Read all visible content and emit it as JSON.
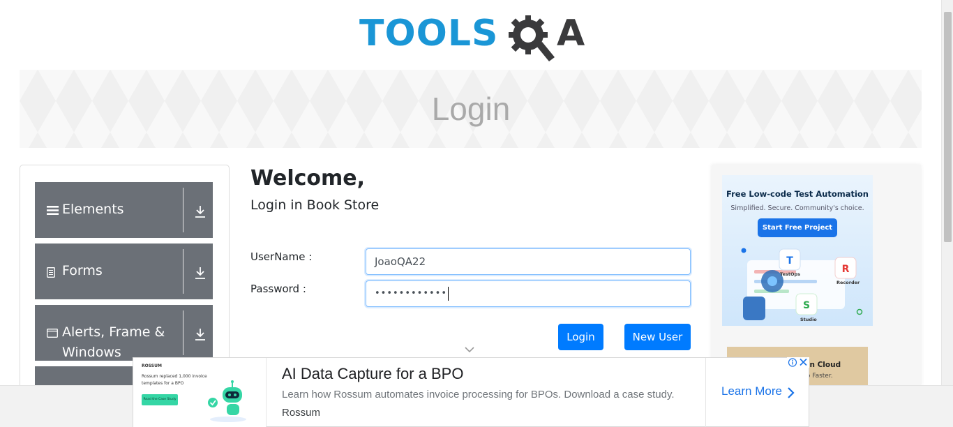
{
  "logo": {
    "part1": "TOOLS",
    "part2": "A",
    "icon": "gear-magnifier-icon",
    "colors": {
      "tools": "#1a96d6",
      "qa": "#3a3a3c"
    }
  },
  "banner": {
    "title": "Login"
  },
  "sidebar": {
    "groups": [
      {
        "label": "Elements",
        "icon": "hamburger-icon"
      },
      {
        "label": "Forms",
        "icon": "document-icon"
      },
      {
        "label": "Alerts, Frame &",
        "label2": "Windows",
        "icon": "window-icon"
      }
    ],
    "group_color": "#6b7077"
  },
  "main": {
    "welcome": "Welcome,",
    "subtitle": "Login in Book Store",
    "username_label": "UserName :",
    "password_label": "Password :",
    "username_value": "JoaoQA22",
    "password_value": "••••••••••••",
    "login_button": "Login",
    "new_user_button": "New User",
    "accent": "#007bff"
  },
  "right_ad": {
    "title": "Free Low-code Test Automation",
    "tagline": "Simplified. Secure. Community's choice.",
    "button": "Start Free Project",
    "labels": [
      "TestOps",
      "Recorder",
      "Studio"
    ],
    "second_title": "sting On Cloud",
    "second_sub": ". Ship Faster."
  },
  "bottom_ad": {
    "thumb_brand": "ROSSUM",
    "thumb_text": "Rossum replaced 1,000 invoice templates for a BPO",
    "thumb_button": "Read the Case Study",
    "headline": "AI Data Capture for a BPO",
    "description": "Learn how Rossum automates invoice processing for BPOs. Download a case study.",
    "advertiser": "Rossum",
    "cta": "Learn More",
    "adchoices": "i",
    "close": "X"
  }
}
